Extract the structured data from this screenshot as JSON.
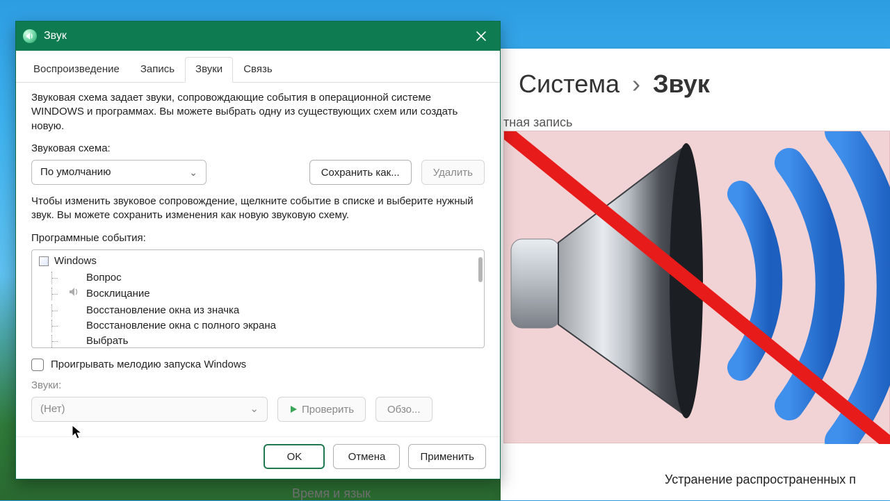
{
  "icons": {
    "app": "speaker-icon",
    "close": "close-icon",
    "chevron": "chevron-down-icon",
    "play": "play-icon"
  },
  "settings_bg": {
    "breadcrumb_root": "Система",
    "breadcrumb_sep": "›",
    "breadcrumb_leaf": "Звук",
    "account_fragment": "тная запись",
    "footer_link": "Устранение распространенных п"
  },
  "window": {
    "title": "Звук",
    "tabs": [
      "Воспроизведение",
      "Запись",
      "Звуки",
      "Связь"
    ],
    "active_tab_index": 2,
    "descr1": "Звуковая схема задает звуки, сопровождающие события в операционной системе WINDOWS и программах. Вы можете выбрать одну из существующих схем или создать новую.",
    "scheme_label": "Звуковая схема:",
    "scheme_value": "По умолчанию",
    "save_as_btn": "Сохранить как...",
    "delete_btn": "Удалить",
    "descr2": "Чтобы изменить звуковое сопровождение, щелкните событие в списке и выберите нужный звук. Вы можете сохранить изменения как новую звуковую схему.",
    "events_label": "Программные события:",
    "tree_root": "Windows",
    "tree_items": [
      {
        "label": "Вопрос",
        "has_sound": false
      },
      {
        "label": "Восклицание",
        "has_sound": true
      },
      {
        "label": "Восстановление окна из значка",
        "has_sound": false
      },
      {
        "label": "Восстановление окна с полного экрана",
        "has_sound": false
      },
      {
        "label": "Выбрать",
        "has_sound": false
      }
    ],
    "startup_checkbox": "Проигрывать мелодию запуска Windows",
    "sounds_label": "Звуки:",
    "sound_value": "(Нет)",
    "test_btn": "Проверить",
    "browse_btn": "Обзо...",
    "ok_btn": "OK",
    "cancel_btn": "Отмена",
    "apply_btn": "Применить"
  },
  "under_window": "Время и язык"
}
